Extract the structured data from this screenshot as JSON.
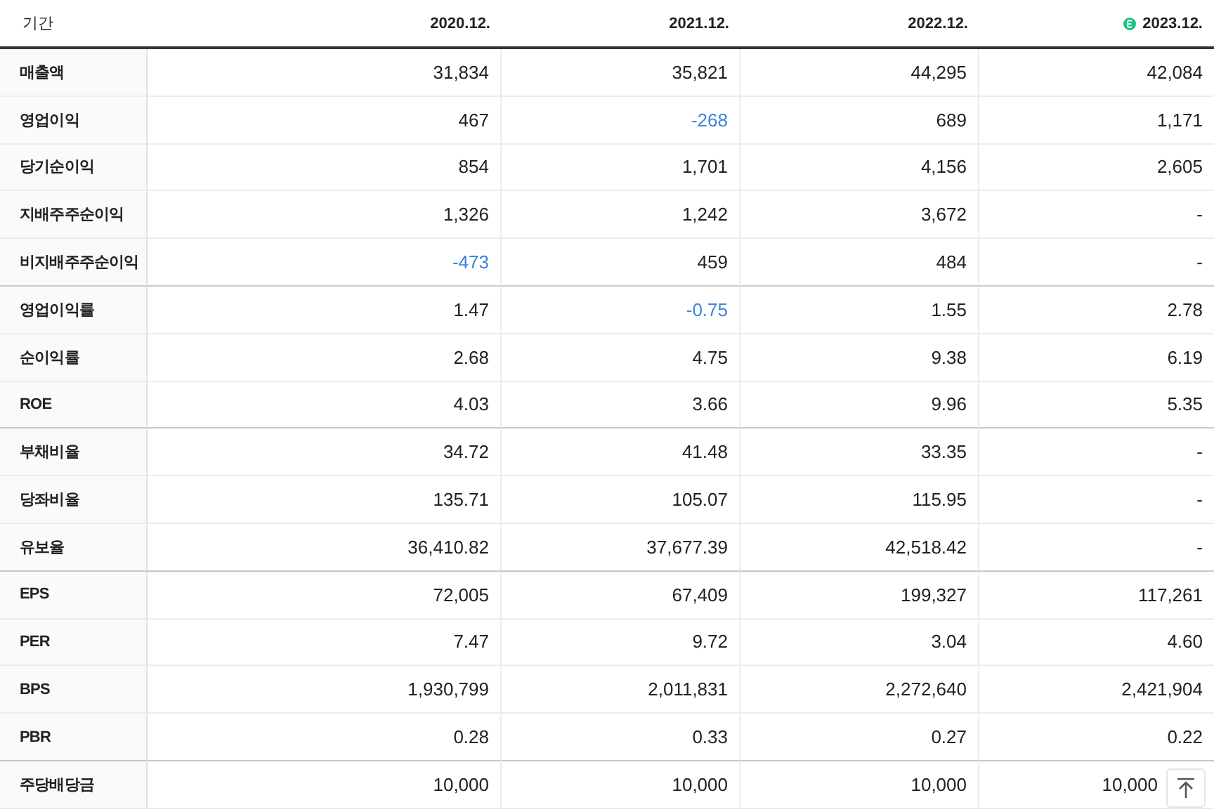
{
  "table": {
    "header": {
      "label": "기간"
    },
    "columns": [
      {
        "label": "2020.12.",
        "estimate": false
      },
      {
        "label": "2021.12.",
        "estimate": false
      },
      {
        "label": "2022.12.",
        "estimate": false
      },
      {
        "label": "2023.12.",
        "estimate": true
      }
    ],
    "rows": [
      {
        "label": "매출액",
        "group_end": false,
        "cells": [
          {
            "text": "31,834",
            "negative": false
          },
          {
            "text": "35,821",
            "negative": false
          },
          {
            "text": "44,295",
            "negative": false
          },
          {
            "text": "42,084",
            "negative": false
          }
        ]
      },
      {
        "label": "영업이익",
        "group_end": false,
        "cells": [
          {
            "text": "467",
            "negative": false
          },
          {
            "text": "-268",
            "negative": true
          },
          {
            "text": "689",
            "negative": false
          },
          {
            "text": "1,171",
            "negative": false
          }
        ]
      },
      {
        "label": "당기순이익",
        "group_end": false,
        "cells": [
          {
            "text": "854",
            "negative": false
          },
          {
            "text": "1,701",
            "negative": false
          },
          {
            "text": "4,156",
            "negative": false
          },
          {
            "text": "2,605",
            "negative": false
          }
        ]
      },
      {
        "label": "지배주주순이익",
        "group_end": false,
        "cells": [
          {
            "text": "1,326",
            "negative": false
          },
          {
            "text": "1,242",
            "negative": false
          },
          {
            "text": "3,672",
            "negative": false
          },
          {
            "text": "-",
            "negative": false
          }
        ]
      },
      {
        "label": "비지배주주순이익",
        "group_end": true,
        "cells": [
          {
            "text": "-473",
            "negative": true
          },
          {
            "text": "459",
            "negative": false
          },
          {
            "text": "484",
            "negative": false
          },
          {
            "text": "-",
            "negative": false
          }
        ]
      },
      {
        "label": "영업이익률",
        "group_end": false,
        "cells": [
          {
            "text": "1.47",
            "negative": false
          },
          {
            "text": "-0.75",
            "negative": true
          },
          {
            "text": "1.55",
            "negative": false
          },
          {
            "text": "2.78",
            "negative": false
          }
        ]
      },
      {
        "label": "순이익률",
        "group_end": false,
        "cells": [
          {
            "text": "2.68",
            "negative": false
          },
          {
            "text": "4.75",
            "negative": false
          },
          {
            "text": "9.38",
            "negative": false
          },
          {
            "text": "6.19",
            "negative": false
          }
        ]
      },
      {
        "label": "ROE",
        "group_end": true,
        "cells": [
          {
            "text": "4.03",
            "negative": false
          },
          {
            "text": "3.66",
            "negative": false
          },
          {
            "text": "9.96",
            "negative": false
          },
          {
            "text": "5.35",
            "negative": false
          }
        ]
      },
      {
        "label": "부채비율",
        "group_end": false,
        "cells": [
          {
            "text": "34.72",
            "negative": false
          },
          {
            "text": "41.48",
            "negative": false
          },
          {
            "text": "33.35",
            "negative": false
          },
          {
            "text": "-",
            "negative": false
          }
        ]
      },
      {
        "label": "당좌비율",
        "group_end": false,
        "cells": [
          {
            "text": "135.71",
            "negative": false
          },
          {
            "text": "105.07",
            "negative": false
          },
          {
            "text": "115.95",
            "negative": false
          },
          {
            "text": "-",
            "negative": false
          }
        ]
      },
      {
        "label": "유보율",
        "group_end": true,
        "cells": [
          {
            "text": "36,410.82",
            "negative": false
          },
          {
            "text": "37,677.39",
            "negative": false
          },
          {
            "text": "42,518.42",
            "negative": false
          },
          {
            "text": "-",
            "negative": false
          }
        ]
      },
      {
        "label": "EPS",
        "group_end": false,
        "cells": [
          {
            "text": "72,005",
            "negative": false
          },
          {
            "text": "67,409",
            "negative": false
          },
          {
            "text": "199,327",
            "negative": false
          },
          {
            "text": "117,261",
            "negative": false
          }
        ]
      },
      {
        "label": "PER",
        "group_end": false,
        "cells": [
          {
            "text": "7.47",
            "negative": false
          },
          {
            "text": "9.72",
            "negative": false
          },
          {
            "text": "3.04",
            "negative": false
          },
          {
            "text": "4.60",
            "negative": false
          }
        ]
      },
      {
        "label": "BPS",
        "group_end": false,
        "cells": [
          {
            "text": "1,930,799",
            "negative": false
          },
          {
            "text": "2,011,831",
            "negative": false
          },
          {
            "text": "2,272,640",
            "negative": false
          },
          {
            "text": "2,421,904",
            "negative": false
          }
        ]
      },
      {
        "label": "PBR",
        "group_end": true,
        "cells": [
          {
            "text": "0.28",
            "negative": false
          },
          {
            "text": "0.33",
            "negative": false
          },
          {
            "text": "0.27",
            "negative": false
          },
          {
            "text": "0.22",
            "negative": false
          }
        ]
      },
      {
        "label": "주당배당금",
        "group_end": false,
        "cells": [
          {
            "text": "10,000",
            "negative": false
          },
          {
            "text": "10,000",
            "negative": false
          },
          {
            "text": "10,000",
            "negative": false
          },
          {
            "text": "10,000",
            "negative": false
          }
        ]
      }
    ]
  }
}
